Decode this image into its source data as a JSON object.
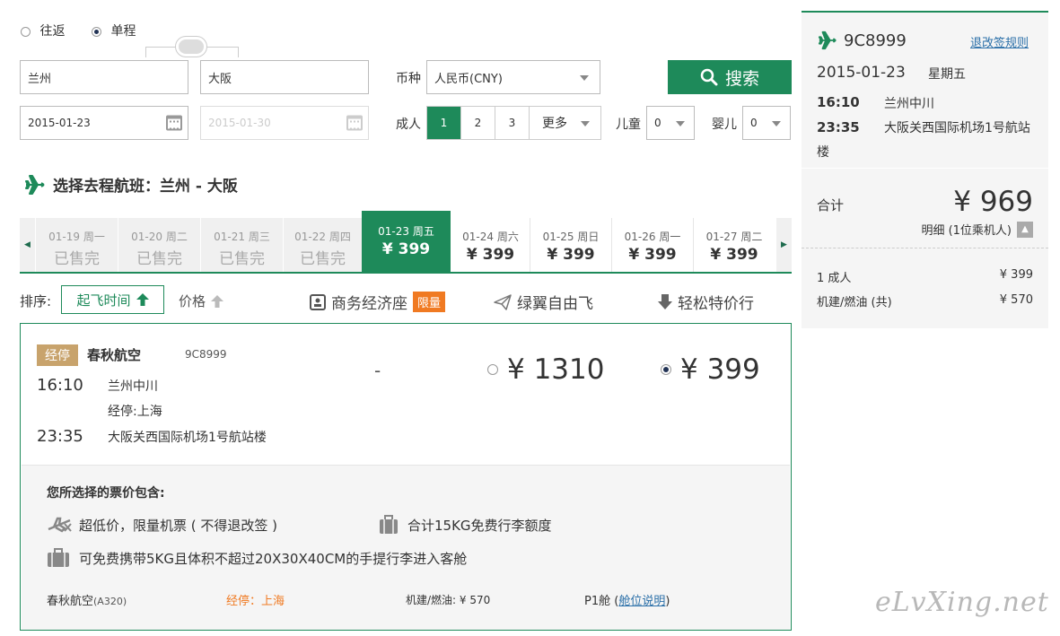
{
  "trip": {
    "round_label": "往返",
    "oneway_label": "单程"
  },
  "from": {
    "value": "兰州"
  },
  "to": {
    "value": "大阪"
  },
  "depart_date": {
    "value": "2015-01-23"
  },
  "return_date": {
    "value": "2015-01-30"
  },
  "currency": {
    "label": "币种",
    "value": "人民币(CNY)"
  },
  "search": {
    "label": "搜索"
  },
  "adults": {
    "label": "成人",
    "options": [
      "1",
      "2",
      "3"
    ],
    "more": "更多",
    "selected": "1"
  },
  "children": {
    "label": "儿童",
    "value": "0"
  },
  "infants": {
    "label": "婴儿",
    "value": "0"
  },
  "section_title": "选择去程航班：兰州 - 大阪",
  "dates": [
    {
      "date": "01-19 周一",
      "status": "已售完"
    },
    {
      "date": "01-20 周二",
      "status": "已售完"
    },
    {
      "date": "01-21 周三",
      "status": "已售完"
    },
    {
      "date": "01-22 周四",
      "status": "已售完"
    },
    {
      "date": "01-23 周五",
      "status": "¥ 399"
    },
    {
      "date": "01-24 周六",
      "status": "¥ 399"
    },
    {
      "date": "01-25 周日",
      "status": "¥ 399"
    },
    {
      "date": "01-26 周一",
      "status": "¥ 399"
    },
    {
      "date": "01-27 周二",
      "status": "¥ 399"
    }
  ],
  "sort": {
    "label": "排序:",
    "depart_time": "起飞时间",
    "price": "价格"
  },
  "filters": {
    "business": "商务经济座",
    "limited_tag": "限量",
    "green": "绿翼自由飞",
    "easy": "轻松特价行"
  },
  "flight": {
    "stop_tag": "经停",
    "airline": "春秋航空",
    "number": "9C8999",
    "dep_time": "16:10",
    "dep_airport": "兰州中川",
    "stopover": "经停:上海",
    "arr_time": "23:35",
    "arr_airport": "大阪关西国际机场1号航站楼",
    "dash": "-",
    "price_a": "¥ 1310",
    "price_b": "¥ 399"
  },
  "includes": {
    "title": "您所选择的票价包含:",
    "item1": "超低价，限量机票 ( 不得退改签 )",
    "item2": "合计15KG免费行李额度",
    "item3": "可免费携带5KG且体积不超过20X30X40CM的手提行李进入客舱",
    "aircraft_airline": "春秋航空",
    "aircraft_model": "(A320)",
    "stop_note": "经停：上海",
    "fuel": "机建/燃油: ¥ 570",
    "cabin": "P1舱",
    "cabin_link": "舱位说明"
  },
  "summary": {
    "flight_no": "9C8999",
    "rules_link": "退改签规则",
    "date": "2015-01-23",
    "weekday": "星期五",
    "dep_time": "16:10",
    "dep_airport": "兰州中川",
    "arr_time": "23:35",
    "arr_airport_line1": "大阪关西国际机场1号航站",
    "arr_airport_line2": "楼",
    "total_label": "合计",
    "total": "¥ 969",
    "detail": "明细 (1位乘机人)",
    "adult_label": "1 成人",
    "adult_price": "¥ 399",
    "fuel_label": "机建/燃油 (共)",
    "fuel_price": "¥ 570"
  },
  "watermark": "eLvXing.net",
  "colors": {
    "accent": "#1e8a5a",
    "orange": "#f07a22",
    "tag_tan": "#c8a36c"
  }
}
